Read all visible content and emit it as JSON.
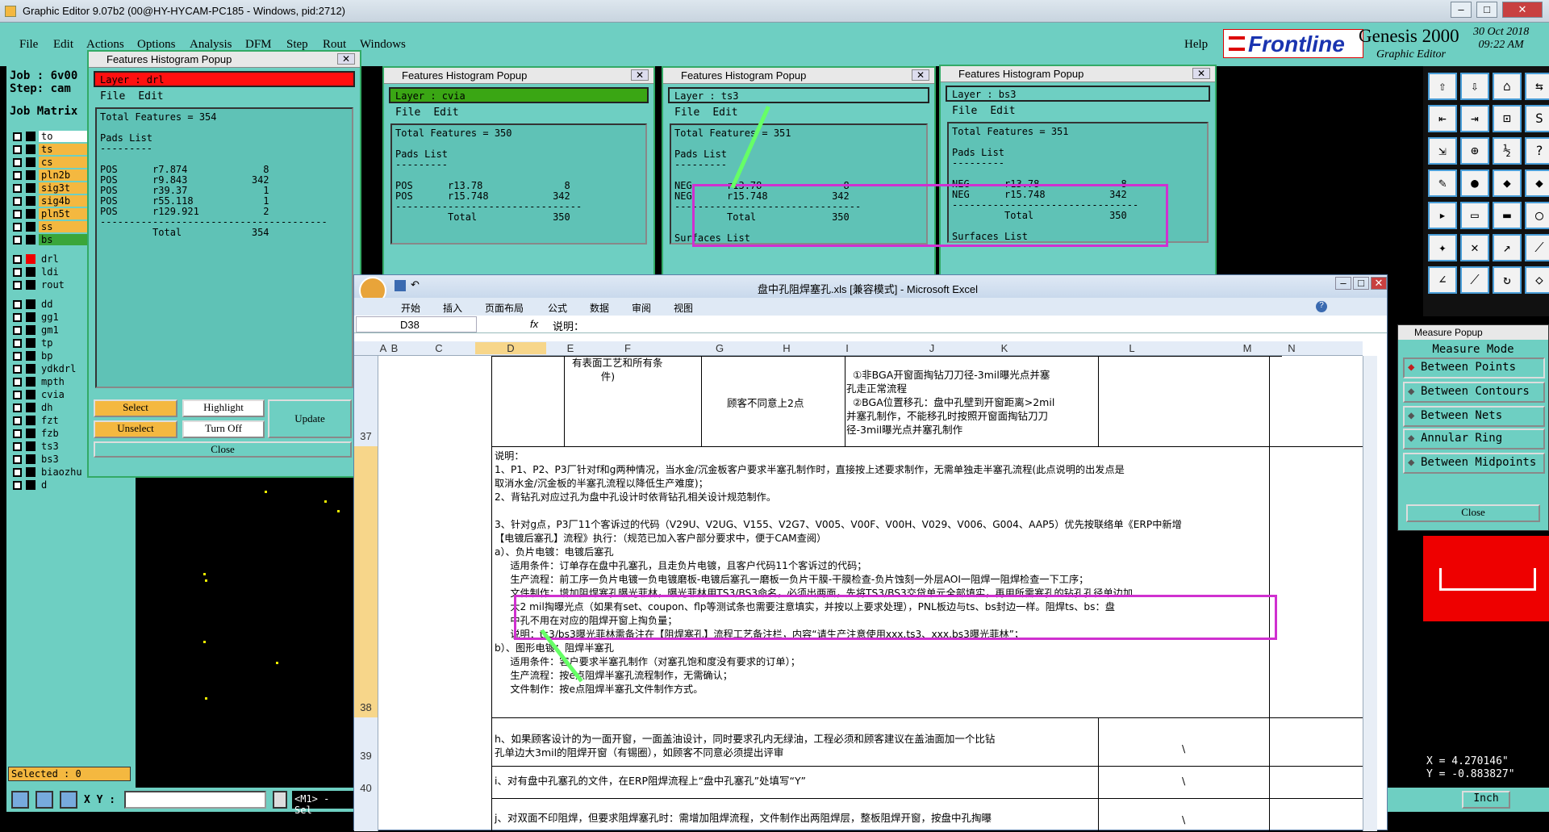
{
  "app": {
    "title": "Graphic Editor 9.07b2 (00@HY-HYCAM-PC185 - Windows, pid:2712)"
  },
  "menu": [
    "File",
    "Edit",
    "Actions",
    "Options",
    "Analysis",
    "DFM",
    "Step",
    "Rout",
    "Windows",
    "Help"
  ],
  "branding": {
    "logo": "Frontline",
    "product": "Genesis 2000",
    "subtitle": "Graphic Editor",
    "date": "30 Oct 2018",
    "time": "09:22 AM"
  },
  "left": {
    "job": "Job : 6v00",
    "step": "Step: cam",
    "matrix": "Job Matrix",
    "selected": "Selected : 0",
    "xy_label": "X Y :",
    "m1": "<M1> - Sel",
    "layers": [
      {
        "name": "to",
        "color": "#ffffff"
      },
      {
        "name": "ts",
        "color": "#f4b840"
      },
      {
        "name": "cs",
        "color": "#f4b840"
      },
      {
        "name": "pln2b",
        "color": "#f4b840"
      },
      {
        "name": "sig3t",
        "color": "#f4b840"
      },
      {
        "name": "sig4b",
        "color": "#f4b840"
      },
      {
        "name": "pln5t",
        "color": "#f4b840"
      },
      {
        "name": "ss",
        "color": "#f4b840"
      },
      {
        "name": "bs",
        "color": "#3aa63a"
      },
      {
        "name": "drl",
        "color": "#6ecfc2"
      },
      {
        "name": "ldi",
        "color": "#6ecfc2"
      },
      {
        "name": "rout",
        "color": "#6ecfc2"
      },
      {
        "name": "dd",
        "color": "#6ecfc2"
      },
      {
        "name": "gg1",
        "color": "#6ecfc2"
      },
      {
        "name": "gm1",
        "color": "#6ecfc2"
      },
      {
        "name": "tp",
        "color": "#6ecfc2"
      },
      {
        "name": "bp",
        "color": "#6ecfc2"
      },
      {
        "name": "ydkdrl",
        "color": "#6ecfc2"
      },
      {
        "name": "mpth",
        "color": "#6ecfc2"
      },
      {
        "name": "cvia",
        "color": "#6ecfc2"
      },
      {
        "name": "dh",
        "color": "#6ecfc2"
      },
      {
        "name": "fzt",
        "color": "#6ecfc2"
      },
      {
        "name": "fzb",
        "color": "#6ecfc2"
      },
      {
        "name": "ts3",
        "color": "#6ecfc2"
      },
      {
        "name": "bs3",
        "color": "#6ecfc2"
      },
      {
        "name": "biaozhu",
        "color": "#6ecfc2"
      },
      {
        "name": "d",
        "color": "#6ecfc2"
      }
    ]
  },
  "histograms": [
    {
      "title": "Features Histogram Popup",
      "layer": "Layer :  drl",
      "layer_color": "#ff1010",
      "file": "File",
      "edit": "Edit",
      "text": "Total Features = 354\n\nPads List\n---------\n\nPOS      r7.874             8\nPOS      r9.843           342\nPOS      r39.37             1\nPOS      r55.118            1\nPOS      r129.921           2\n---------------------------------------\n         Total            354"
    },
    {
      "title": "Features Histogram Popup",
      "layer": "Layer :  cvia",
      "layer_color": "#3aa614",
      "file": "File",
      "edit": "Edit",
      "text": "Total Features = 350\n\nPads List\n---------\n\nPOS      r13.78              8\nPOS      r15.748           342\n--------------------------------\n         Total             350"
    },
    {
      "title": "Features Histogram Popup",
      "layer": "Layer :  ts3",
      "layer_color": "#6ecfc2",
      "file": "File",
      "edit": "Edit",
      "text": "Total Features = 351\n\nPads List\n---------\n\nNEG      r13.78              8\nNEG      r15.748           342\n--------------------------------\n         Total             350\n\nSurfaces List"
    },
    {
      "title": "Features Histogram Popup",
      "layer": "Layer :  bs3",
      "layer_color": "#6ecfc2",
      "file": "File",
      "edit": "Edit",
      "text": "Total Features = 351\n\nPads List\n---------\n\nNEG      r13.78              8\nNEG      r15.748           342\n--------------------------------\n         Total             350\n\nSurfaces List"
    }
  ],
  "hist_buttons": {
    "select": "Select",
    "highlight": "Highlight",
    "update": "Update",
    "unselect": "Unselect",
    "turnoff": "Turn Off",
    "close": "Close"
  },
  "excel": {
    "title": "盘中孔阻焊塞孔.xls  [兼容模式] - Microsoft Excel",
    "tabs": [
      "开始",
      "插入",
      "页面布局",
      "公式",
      "数据",
      "审阅",
      "视图"
    ],
    "cellref": "D38",
    "fx": "fx",
    "formula": "说明：",
    "columns": [
      "A",
      "B",
      "C",
      "D",
      "E",
      "F",
      "G",
      "H",
      "I",
      "J",
      "K",
      "L",
      "M",
      "N"
    ],
    "rows": [
      "37",
      "38",
      "39",
      "40"
    ],
    "r37_e": "有表面工艺和所有条\n         件)",
    "r37_g": "顾客不同意上2点",
    "r37_i": "  ①非BGA开窗面掏钻刀刀径-3mil曝光点并塞\n孔走正常流程\n  ②BGA位置移孔：盘中孔壁到开窗距离>2mil\n并塞孔制作，不能移孔时按照开窗面掏钻刀刀\n径-3mil曝光点并塞孔制作",
    "r38": "说明：\n1、P1、P2、P3厂针对f和g两种情况，当水金/沉金板客户要求半塞孔制作时，直接按上述要求制作，无需单独走半塞孔流程(此点说明的出发点是\n取消水金/沉金板的半塞孔流程以降低生产难度)；\n2、背钻孔对应过孔为盘中孔设计时依背钻孔相关设计规范制作。\n\n3、针对g点，P3厂11个客诉过的代码（V29U、V2UG、V155、V2G7、V005、V00F、V00H、V029、V006、G004、AAP5）优先按联络单《ERP中新增\n【电镀后塞孔】流程》执行：（规范已加入客户部分要求中，便于CAM查阅）\na）、负片电镀：电镀后塞孔\n     适用条件：订单存在盘中孔塞孔，且走负片电镀，且客户代码11个客诉过的代码；\n     生产流程：前工序一负片电镀一负电镀磨板-电镀后塞孔一磨板一负片干膜-干膜检查-负片蚀刻一外层AOI一阻焊一阻焊检查一下工序；\n     文件制作：增加阻焊塞孔曝光菲林，曝光菲林用TS3/BS3命名，必须出两面，先将TS3/BS3交贷单元全部填实，再用所需塞孔的钻孔孔径单边加\n     大2 mil掏曝光点（如果有set、coupon、flp等测试条也需要注意填实，并按以上要求处理），PNL板边与ts、bs封边一样。阻焊ts、bs：盘\n     中孔不用在对应的阻焊开窗上掏负量；\n     说明：ts3/bs3曝光菲林需备注在【阻焊塞孔】流程工艺备注栏，内容“请生产注意使用xxx.ts3、xxx.bs3曝光菲林”；\nb）、图形电镀：阻焊半塞孔\n     适用条件：客户要求半塞孔制作（对塞孔饱和度没有要求的订单）；\n     生产流程：按e点阻焊半塞孔流程制作，无需确认；\n     文件制作：按e点阻焊半塞孔文件制作方式。",
    "r39": "h、如果顾客设计的为一面开窗，一面盖油设计，同时要求孔内无绿油，工程必须和顾客建议在盖油面加一个比钻\n孔单边大3mil的阻焊开窗（有锡圈），如顾客不同意必须提出评审",
    "r40": "i、对有盘中孔塞孔的文件，在ERP阻焊流程上“盘中孔塞孔”处填写“Y”",
    "r41": "j、对双面不印阻焊，但要求阻焊塞孔时：需增加阻焊流程，文件制作出两阻焊层，整板阻焊开窗，按盘中孔掏曝",
    "backslash": "\\"
  },
  "measure": {
    "title": "Measure Popup",
    "mode": "Measure Mode",
    "options": [
      "Between Points",
      "Between Contours",
      "Between Nets",
      "Annular Ring",
      "Between Midpoints"
    ],
    "close": "Close",
    "x": "X = 4.270146\"",
    "y": "Y = -0.883827\"",
    "unit": "Inch"
  }
}
